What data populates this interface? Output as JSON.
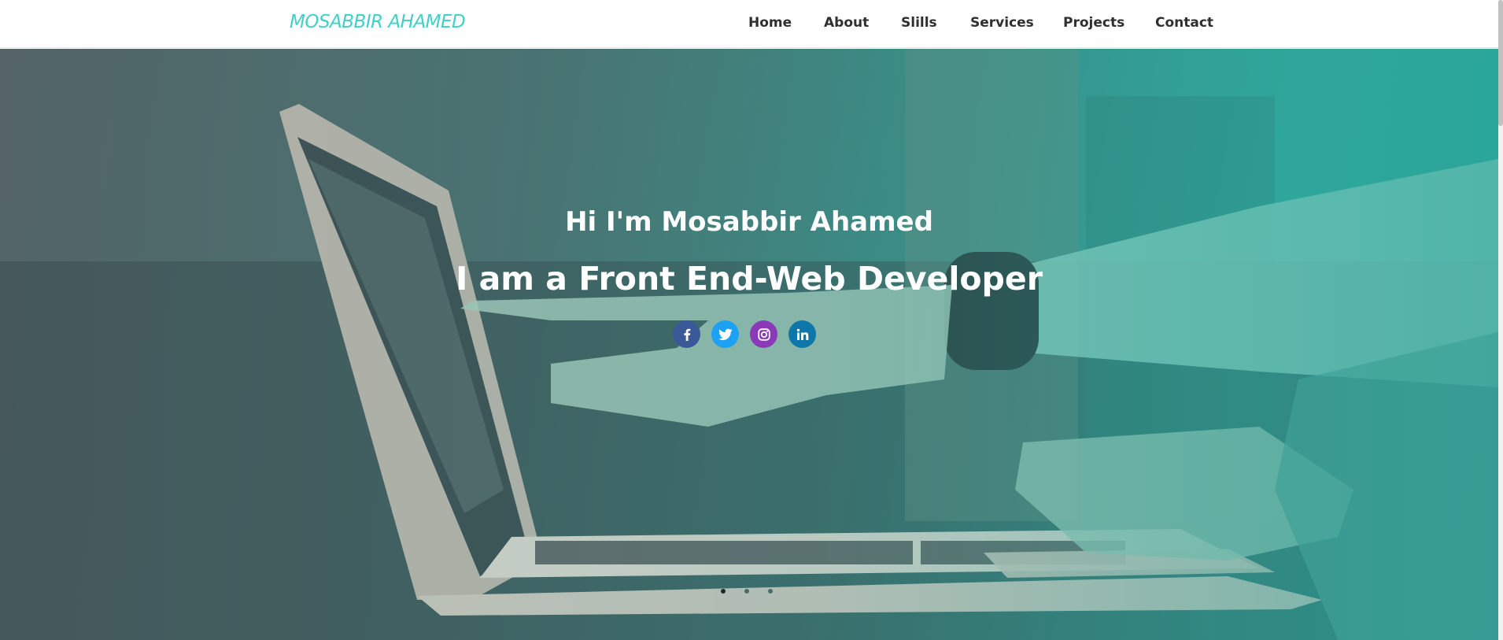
{
  "brand": {
    "name": "MOSABBIR AHAMED",
    "color": "#3fd0c6"
  },
  "nav": {
    "items": [
      {
        "label": "Home"
      },
      {
        "label": "About"
      },
      {
        "label": "Slills"
      },
      {
        "label": "Services"
      },
      {
        "label": "Projects"
      },
      {
        "label": "Contact"
      }
    ]
  },
  "hero": {
    "title": "Hi I'm Mosabbir Ahamed",
    "subtitle": "I am a Front End-Web Developer",
    "image_overlay_color": "#2aa69a",
    "socials": [
      {
        "icon": "facebook-icon",
        "color": "#3b5998"
      },
      {
        "icon": "twitter-icon",
        "color": "#1da1f2"
      },
      {
        "icon": "instagram-icon",
        "color": "#8a3ab9"
      },
      {
        "icon": "linkedin-icon",
        "color": "#0e76a8"
      }
    ],
    "carousel": {
      "slides": 3,
      "active": 1
    }
  }
}
